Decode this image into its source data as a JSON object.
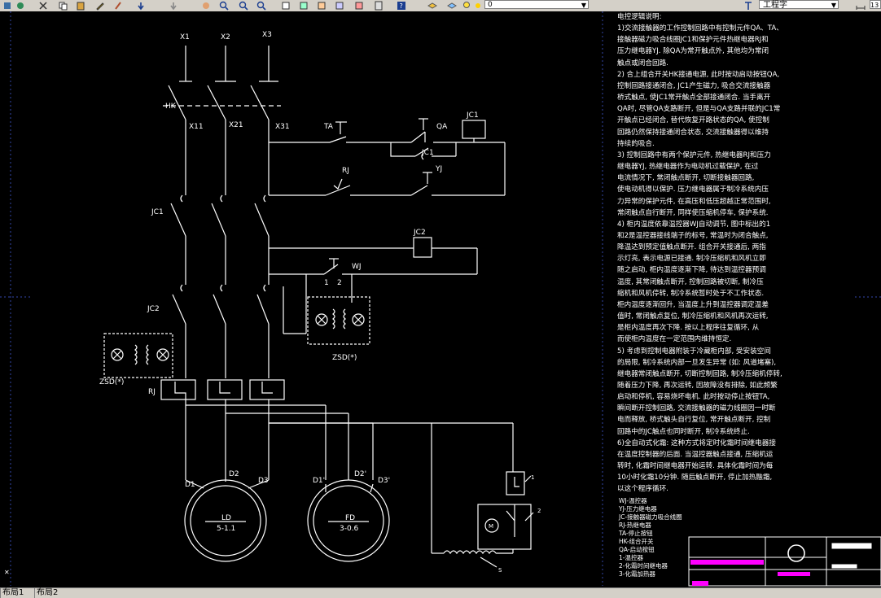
{
  "toolbar": {
    "layer_value": "0",
    "style_value": "工程字",
    "scale_value": "13"
  },
  "drawing": {
    "labels": {
      "x1": "X1",
      "x2": "X2",
      "x3": "X3",
      "hk": "HK",
      "x11": "X11",
      "x21": "X21",
      "x31": "X31",
      "ta": "TA",
      "qa": "QA",
      "jc1_coil": "JC1",
      "jc1_contact": "JC1",
      "rj_contact": "RJ",
      "yj": "YJ",
      "jc1_main": "JC1",
      "jc2_coil": "JC2",
      "wj": "WJ",
      "wj_1": "1",
      "wj_2": "2",
      "jc2_main": "JC2",
      "zsd_right": "ZSD(*)",
      "zsd_left": "ZSD(*)",
      "rj_left": "RJ",
      "d1": "D1",
      "d2": "D2",
      "d3": "D3",
      "d1p": "D1'",
      "d2p": "D2'",
      "d3p": "D3'",
      "ld": "LD",
      "ld_spec": "5-1.1",
      "fd": "FD",
      "fd_spec": "3-0.6",
      "m": "M",
      "s": "S",
      "n1": "1",
      "n2": "2"
    },
    "notes": [
      "电控逻辑说明:",
      "1)交流接触器的工作控制回路中有控制元件QA、TA、",
      "接触器磁力吸合线圈JC1和保护元件热继电器RJ和",
      "压力继电器YJ. 除QA为常开触点外, 其他均为常闭",
      "触点或闭合回路.",
      "2) 合上组合开关HK接通电源, 此时按动启动按钮QA,",
      "控制回路接通闭合, JC1产生磁力, 吸合交流接触器",
      "桥式触点, 使JC1常开触点全部接通闭合. 当手离开",
      "QA时, 尽管QA支路断开, 但是与QA支路并联的JC1常",
      "开触点已经闭合, 替代恢复开路状态的QA, 使控制",
      "回路仍然保持接通闭合状态, 交流接触器得以维持",
      "持续的吸合.",
      "3) 控制回路中有两个保护元件, 热继电器RJ和压力",
      "继电器YJ, 热继电器作为电动机过载保护, 在过",
      "电流情况下, 常闭触点断开, 切断接触器回路,",
      "使电动机得以保护. 压力继电器属于制冷系统内压",
      "力异常的保护元件, 在高压和低压超越正常范围时,",
      "常闭触点自行断开, 同样使压缩机停车, 保护系统.",
      "4) 柜内温度依靠温控器WJ自动调节, 图中标出的1",
      "和2是温控器接线端子的标号, 常温时为闭合触点,",
      "降温达到预定值触点断开. 组合开关接通后, 两指",
      "示灯亮, 表示电源已接通. 制冷压缩机和风机立即",
      "随之启动, 柜内温度逐渐下降, 待达到温控器预调",
      "温度, 其常闭触点断开, 控制回路被切断, 制冷压",
      "缩机和风机停转, 制冷系统暂时处于不工作状态.",
      "柜内温度逐渐回升, 当温度上升到温控器调定温差",
      "值时, 常闭触点复位, 制冷压缩机和风机再次运转,",
      "是柜内温度再次下降. 按以上程序往复循环, 从",
      "而使柜内温度在一定范围内维持恒定.",
      "5) 考虑到控制电器附装于冷藏柜内部, 受安装空间",
      "的局限, 制冷系统内部一旦发生异常 (如: 风道堵塞),",
      "继电器常闭触点断开, 切断控制回路, 制冷压缩机停转,",
      "随着压力下降, 再次运转, 因故障没有排除, 如此频繁",
      "启动和停机, 容易烧坏电机. 此时按动停止按钮TA,",
      "瞬间断开控制回路, 交流接触器的磁力线圈因一时断",
      "电而释放, 桥式触头自行复位, 常开触点断开, 控制",
      "回路中的JC触点也同时断开, 制冷系统终止.",
      "6)全自动式化霜: 这种方式将定时化霜时间继电器接",
      "在温度控制器的后面. 当温控器触点接通, 压缩机运",
      "转时, 化霜时间继电器开始运转. 具体化霜时间为每",
      "10小时化霜10分钟. 随后触点断开, 停止加热融霜,",
      "以这个程序循环."
    ],
    "legend": [
      "WJ-温控器",
      "YJ-压力继电器",
      "JC-接触器磁力吸合线圈",
      "RJ-热继电器",
      "TA-停止按钮",
      "HK-组合开关",
      "QA-启动按钮",
      "1-温控器",
      "2-化霜时间继电器",
      "3-化霜加热器"
    ]
  },
  "layout_tabs": [
    "布局1",
    "布局2"
  ],
  "colors": {
    "canvas": "#000000",
    "lines": "#ffffff",
    "title_block": "#ff00ff",
    "toolbar": "#d4d0c8"
  }
}
